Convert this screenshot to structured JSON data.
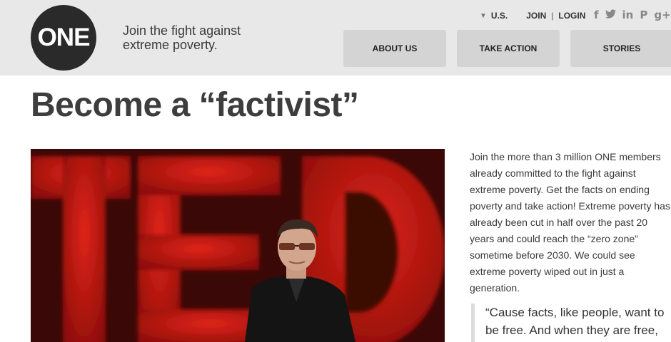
{
  "header": {
    "logo_text": "ONE",
    "tagline": "Join the fight against extreme poverty.",
    "region_label": "U.S.",
    "join_label": "JOIN",
    "separator": "|",
    "login_label": "LOGIN",
    "social_icons": [
      "facebook-icon",
      "twitter-icon",
      "linkedin-icon",
      "pinterest-icon",
      "googleplus-icon"
    ],
    "nav": [
      {
        "label": "ABOUT US"
      },
      {
        "label": "TAKE ACTION"
      },
      {
        "label": "STORIES"
      }
    ]
  },
  "main": {
    "title": "Become a “factivist”",
    "hero_image": "Speaker in black jacket with glasses and headset mic on stage in front of large red TED letters",
    "intro": "Join the more than 3 million ONE members already committed to the fight against extreme poverty. Get the facts on ending poverty and take action! Extreme poverty has already been cut in half over the past 20 years and could reach the “zero zone” sometime before 2030. We could see extreme poverty wiped out in just a generation.",
    "quote": "“Cause facts, like people, want to be free. And when they are free, liberty"
  },
  "colors": {
    "header_bg": "#e8e8e8",
    "nav_bg": "#d4d4d4",
    "logo_bg": "#2a2a2a",
    "ted_red": "#c8160f"
  }
}
